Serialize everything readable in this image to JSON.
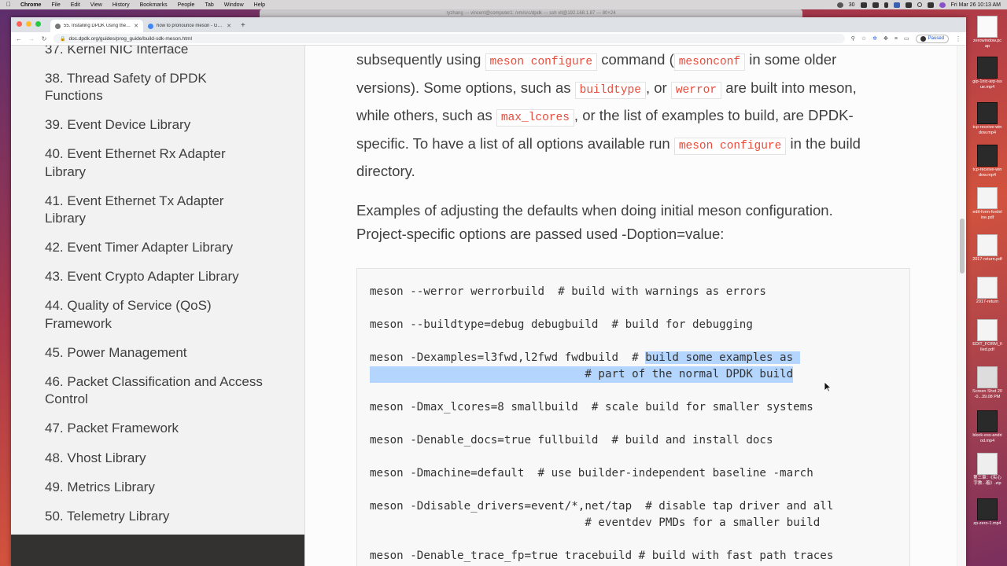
{
  "menubar": {
    "app": "Chrome",
    "items": [
      "File",
      "Edit",
      "View",
      "History",
      "Bookmarks",
      "People",
      "Tab",
      "Window",
      "Help"
    ],
    "battery": "30",
    "clock": "Fri Mar 26  10:13 AM"
  },
  "terminal": {
    "title": "ryzhang — vincent@computer1: /vm/src/dpdk — ssh vlt@192.168.1.87 — 80×24"
  },
  "browser": {
    "tabs": [
      {
        "label": "55. Installing DPDK Using the …"
      },
      {
        "label": "how to pronounce meson - Goo…"
      }
    ],
    "url": "doc.dpdk.org/guides/prog_guide/build-sdk-meson.html",
    "profile_status": "Paused"
  },
  "sidebar": {
    "items": [
      "37. Kernel NIC Interface",
      "38. Thread Safety of DPDK",
      "Functions",
      "39. Event Device Library",
      "40. Event Ethernet Rx Adapter",
      "Library",
      "41. Event Ethernet Tx Adapter",
      "Library",
      "42. Event Timer Adapter Library",
      "43. Event Crypto Adapter Library",
      "44. Quality of Service (QoS)",
      "Framework",
      "45. Power Management",
      "46. Packet Classification and Access",
      "Control",
      "47. Packet Framework",
      "48. Vhost Library",
      "49. Metrics Library",
      "50. Telemetry Library"
    ]
  },
  "content": {
    "p1": {
      "t1": "subsequently using ",
      "c1": "meson configure",
      "t2": " command (",
      "c2": "mesonconf",
      "t3": " in some older",
      "t4": "versions). Some options, such as ",
      "c3": "buildtype",
      "t5": ", or ",
      "c4": "werror",
      "t6": " are built into meson,",
      "t7": "while others, such as ",
      "c5": "max_lcores",
      "t8": ", or the list of examples to build, are DPDK-",
      "t9": "specific. To have a list of all options available run ",
      "c6": "meson configure",
      "t10": " in the build",
      "t11": "directory."
    },
    "p2": {
      "line1": "Examples of adjusting the defaults when doing initial meson configuration.",
      "line2": "Project-specific options are passed used -Doption=value:"
    },
    "code": {
      "l1": "meson --werror werrorbuild  # build with warnings as errors",
      "l2": "meson --buildtype=debug debugbuild  # build for debugging",
      "l3a": "meson -Dexamples=l3fwd,l2fwd fwdbuild  # ",
      "l3b": "build some examples as ",
      "l4a": "                                ",
      "l4b": "# part of the normal DPDK build",
      "l5": "meson -Dmax_lcores=8 smallbuild  # scale build for smaller systems",
      "l6": "meson -Denable_docs=true fullbuild  # build and install docs",
      "l7": "meson -Dmachine=default  # use builder-independent baseline -march",
      "l8": "meson -Ddisable_drivers=event/*,net/tap  # disable tap driver and all",
      "l9": "                                # eventdev PMDs for a smaller build",
      "l10": "meson -Denable_trace_fp=true tracebuild # build with fast path traces"
    }
  },
  "desktop_files": [
    "zerowindow.pcap",
    "gip-1nic-arp-issue.mp4",
    "tcp-receive-window.mp4",
    "tcp-receive-window.mp4",
    "edit-form-fordeline.pdf",
    "2017-return.pdf",
    "2017-return",
    "EDIT_FORM_filled.pdf",
    "Screen Shot 20-0...39.08 PM",
    "block-esx-andriod.mp4",
    "第三章：《实心字教...着》.zip",
    "zp-zero-1.mp4"
  ]
}
